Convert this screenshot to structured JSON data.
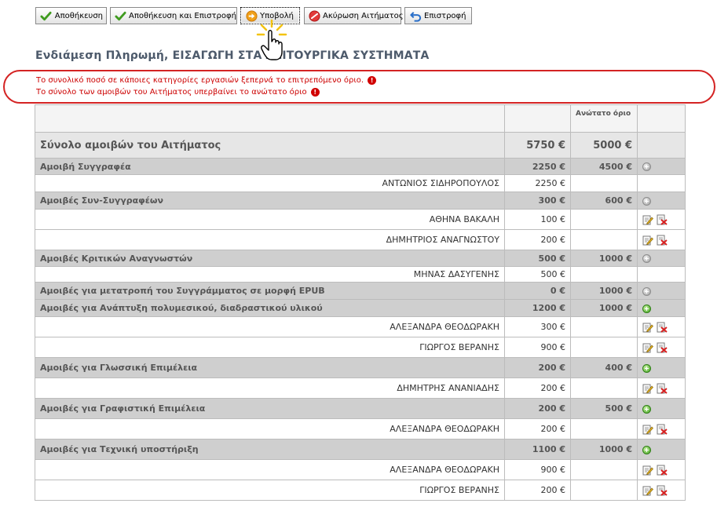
{
  "toolbar": {
    "save": "Αποθήκευση",
    "save_return": "Αποθήκευση και Επιστροφή",
    "submit": "Υποβολή",
    "cancel": "Ακύρωση Αιτήματος",
    "back": "Επιστροφή"
  },
  "page_title": "Ενδιάμεση Πληρωμή, ΕΙΣΑΓΩΓΗ ΣΤΑ ΛΕΙΤΟΥΡΓΙΚΑ ΣΥΣΤΗΜΑΤΑ",
  "errors": [
    "Το συνολικό ποσό σε κάποιες κατηγορίες εργασιών ξεπερνά το επιτρεπόμενο όριο.",
    "Το σύνολο των αμοιβών του Αιτήματος υπερβαίνει το ανώτατο όριο"
  ],
  "table": {
    "header_limit": "Ανώτατο όριο",
    "total": {
      "label": "Σύνολο αμοιβών του Αιτήματος",
      "amount": "5750 €",
      "limit": "5000 €"
    },
    "categories": [
      {
        "label": "Αμοιβή Συγγραφέα",
        "amount": "2250 €",
        "limit": "4500 €",
        "over": false,
        "addable": false,
        "people": [
          {
            "name": "ΑΝΤΩΝΙΟΣ ΣΙΔΗΡΟΠΟΥΛΟΣ",
            "amount": "2250 €",
            "editable": false
          }
        ]
      },
      {
        "label": "Αμοιβές Συν-Συγγραφέων",
        "amount": "300 €",
        "limit": "600 €",
        "over": false,
        "addable": false,
        "people": [
          {
            "name": "ΑΘΗΝΑ ΒΑΚΑΛΗ",
            "amount": "100 €",
            "editable": true
          },
          {
            "name": "ΔΗΜΗΤΡΙΟΣ ΑΝΑΓΝΩΣΤΟΥ",
            "amount": "200 €",
            "editable": true
          }
        ]
      },
      {
        "label": "Αμοιβές Κριτικών Αναγνωστών",
        "amount": "500 €",
        "limit": "1000 €",
        "over": false,
        "addable": false,
        "people": [
          {
            "name": "ΜΗΝΑΣ ΔΑΣΥΓΕΝΗΣ",
            "amount": "500 €",
            "editable": false
          }
        ]
      },
      {
        "label": "Αμοιβές για μετατροπή του Συγγράμματος σε μορφή EPUB",
        "amount": "0 €",
        "limit": "1000 €",
        "over": false,
        "addable": false,
        "people": []
      },
      {
        "label": "Αμοιβές για Ανάπτυξη πολυμεσικού, διαδραστικού υλικού",
        "amount": "1200 €",
        "limit": "1000 €",
        "over": true,
        "addable": true,
        "people": [
          {
            "name": "ΑΛΕΞΑΝΔΡΑ ΘΕΟΔΩΡΑΚΗ",
            "amount": "300 €",
            "editable": true
          },
          {
            "name": "ΓΙΩΡΓΟΣ ΒΕΡΑΝΗΣ",
            "amount": "900 €",
            "editable": true
          }
        ]
      },
      {
        "label": "Αμοιβές για Γλωσσική Επιμέλεια",
        "amount": "200 €",
        "limit": "400 €",
        "over": false,
        "addable": true,
        "people": [
          {
            "name": "ΔΗΜΗΤΡΗΣ ΑΝΑΝΙΑΔΗΣ",
            "amount": "200 €",
            "editable": true
          }
        ]
      },
      {
        "label": "Αμοιβές για Γραφιστική Επιμέλεια",
        "amount": "200 €",
        "limit": "500 €",
        "over": false,
        "addable": true,
        "people": [
          {
            "name": "ΑΛΕΞΑΝΔΡΑ ΘΕΟΔΩΡΑΚΗ",
            "amount": "200 €",
            "editable": true
          }
        ]
      },
      {
        "label": "Αμοιβές για Τεχνική υποστήριξη",
        "amount": "1100 €",
        "limit": "1000 €",
        "over": true,
        "addable": true,
        "people": [
          {
            "name": "ΑΛΕΞΑΝΔΡΑ ΘΕΟΔΩΡΑΚΗ",
            "amount": "900 €",
            "editable": true
          },
          {
            "name": "ΓΙΩΡΓΟΣ ΒΕΡΑΝΗΣ",
            "amount": "200 €",
            "editable": true
          }
        ]
      }
    ]
  },
  "colors": {
    "over_limit": "#d00000",
    "limit": "#2c8a1c",
    "error_border": "#d42323",
    "category_bg": "#cfcfcf"
  },
  "icons": {
    "save": "checkmark-icon",
    "submit": "arrow-right-circle-icon",
    "cancel": "no-entry-icon",
    "back": "undo-arrow-icon",
    "add": "add-circle-icon",
    "edit": "edit-icon",
    "delete": "delete-icon",
    "cursor": "hand-pointer-icon"
  }
}
